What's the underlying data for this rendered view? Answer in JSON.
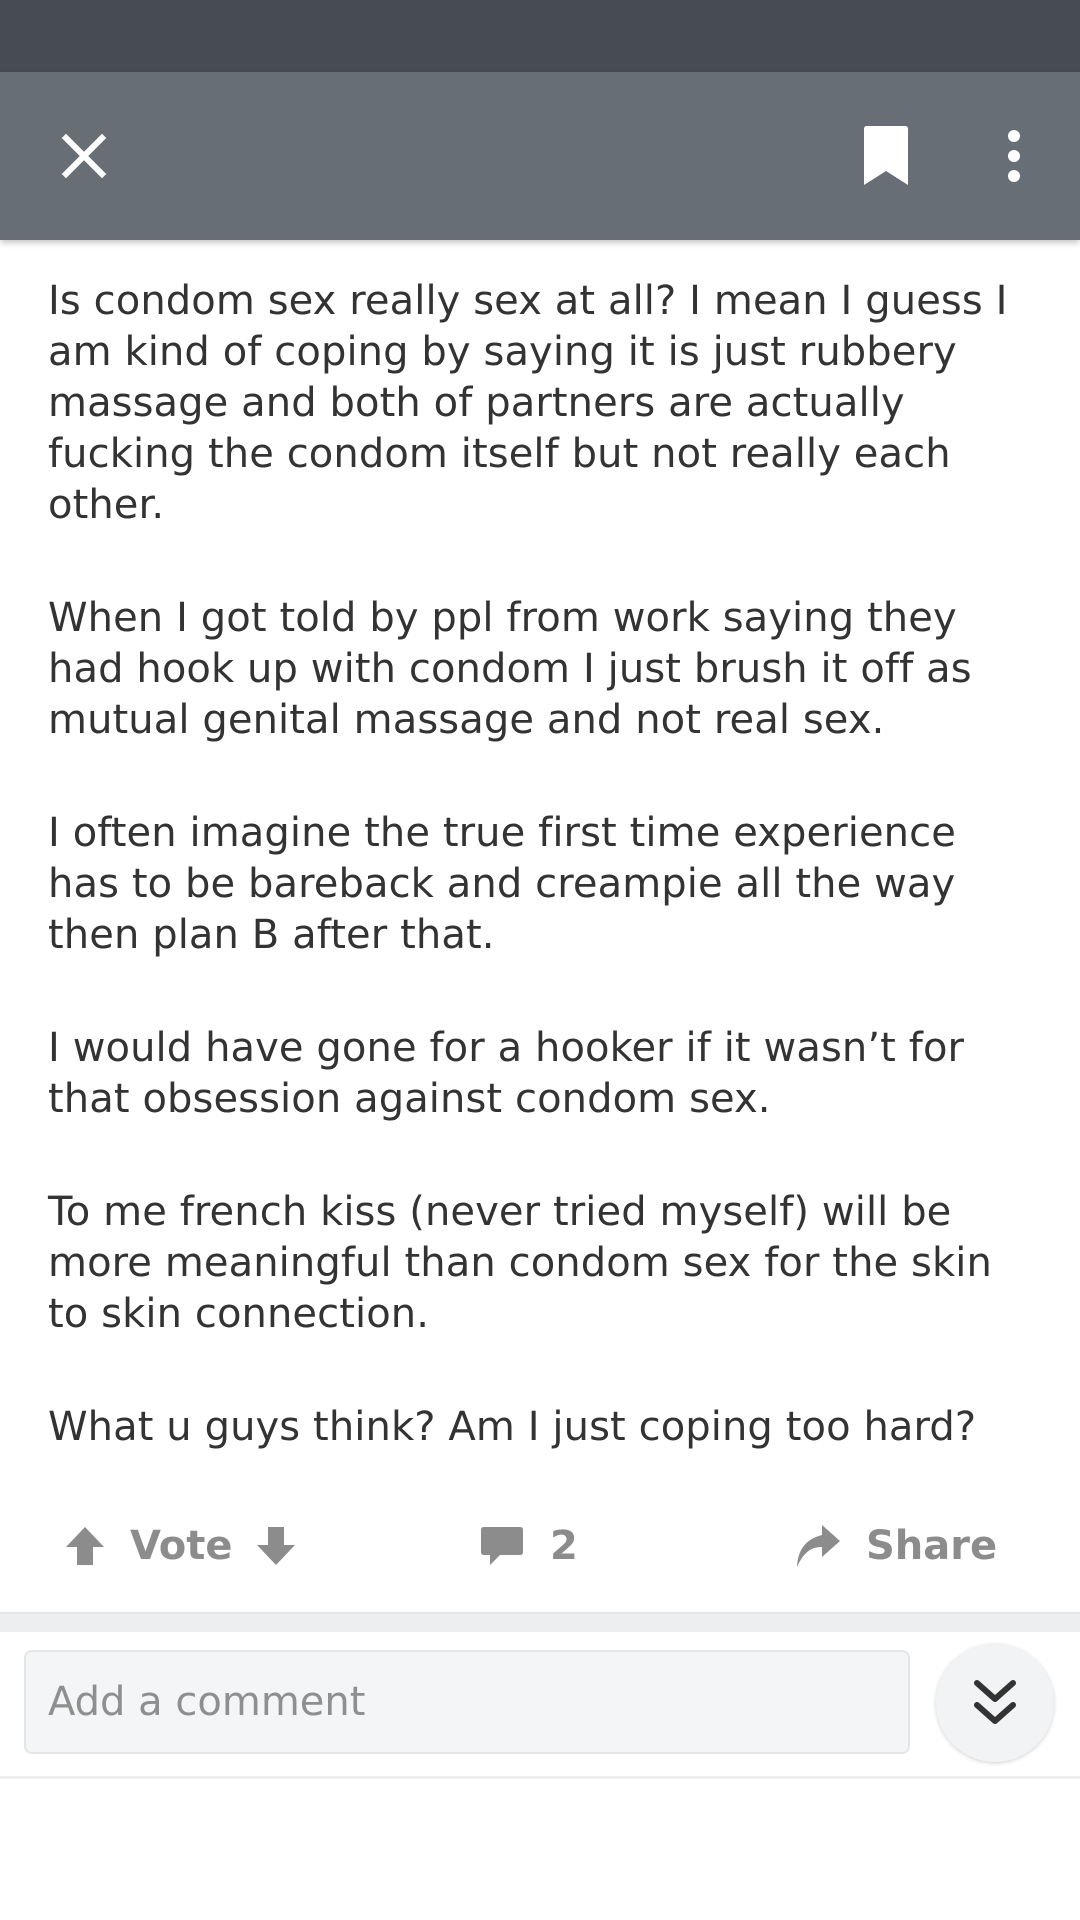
{
  "colors": {
    "status_bar": "#464c51",
    "app_bar": "#686e75",
    "body_text": "#333333",
    "action_gray": "#8c8c8c"
  },
  "toolbar": {
    "close_icon": "close-icon",
    "bookmark_icon": "bookmark-icon",
    "more_icon": "more-vertical-icon"
  },
  "post": {
    "paragraphs": [
      "Is condom sex really sex at all? I mean I guess I am kind of coping by saying it is just rubbery massage and both of partners are actually fucking the condom itself but not really each other.",
      "When I got told by ppl from work saying they had hook up with condom I just brush it off as mutual genital massage and not real sex.",
      "I often imagine the true first time experience has to be bareback and creampie all the way then plan B after that.",
      "I would have gone for a hooker if it wasn’t for that obsession against condom sex.",
      "To me french kiss (never tried myself) will be more meaningful than condom sex for the skin to skin connection.",
      "What u guys think? Am I just coping too hard?"
    ]
  },
  "actions": {
    "vote_label": "Vote",
    "comment_count": "2",
    "share_label": "Share"
  },
  "comment_bar": {
    "placeholder": "Add a comment"
  }
}
